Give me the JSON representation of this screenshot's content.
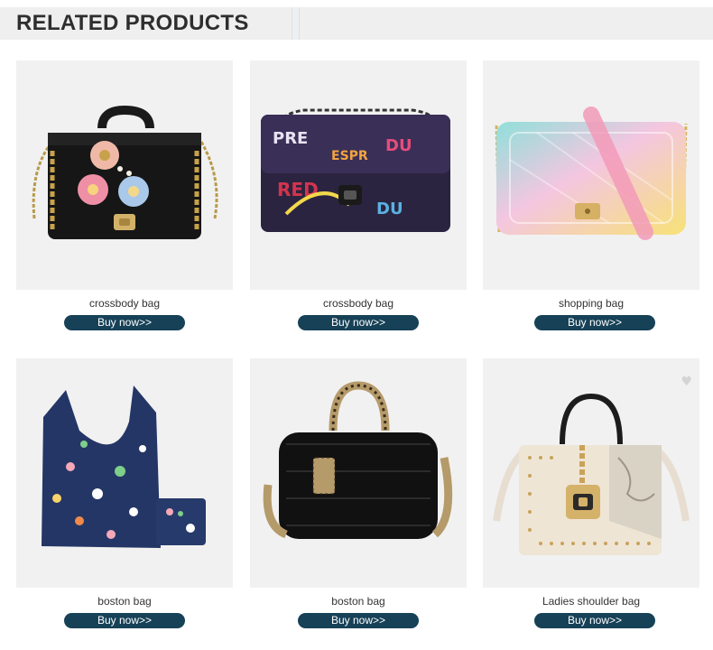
{
  "header": {
    "title": "RELATED PRODUCTS"
  },
  "products": [
    {
      "name": "crossbody bag",
      "button": "Buy now>>"
    },
    {
      "name": "crossbody bag",
      "button": "Buy now>>"
    },
    {
      "name": "shopping bag",
      "button": "Buy now>>"
    },
    {
      "name": "boston bag",
      "button": "Buy now>>"
    },
    {
      "name": "boston bag",
      "button": "Buy now>>"
    },
    {
      "name": "Ladies shoulder bag",
      "button": "Buy now>>"
    }
  ],
  "colors": {
    "header_bg": "#efefef",
    "button_bg": "#164157",
    "card_bg": "#f1f1f1"
  }
}
